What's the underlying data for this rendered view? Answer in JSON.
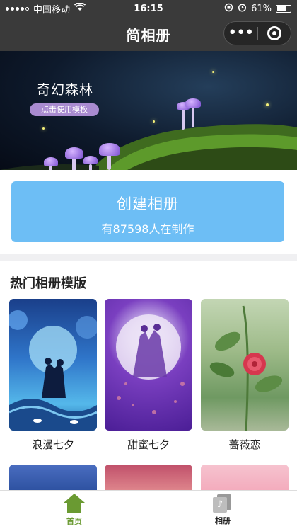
{
  "status_bar": {
    "carrier": "中国移动",
    "time": "16:15",
    "battery": "61%"
  },
  "nav": {
    "title": "简相册"
  },
  "banner": {
    "title": "奇幻森林",
    "tag": "点击使用模板"
  },
  "create": {
    "title": "创建相册",
    "subtitle": "有87598人在制作"
  },
  "section": {
    "title": "热门相册模版"
  },
  "templates": [
    {
      "label": "浪漫七夕"
    },
    {
      "label": "甜蜜七夕"
    },
    {
      "label": "蔷薇恋"
    }
  ],
  "tabbar": {
    "items": [
      {
        "label": "首页",
        "color": "#6a9a32",
        "icon": "home-icon",
        "active": true
      },
      {
        "label": "相册",
        "color": "#222222",
        "icon": "album-icon",
        "active": false
      }
    ]
  },
  "colors": {
    "accent": "#6dbef5",
    "navbar": "#3a3a3a",
    "tag": "#a98bd0"
  }
}
